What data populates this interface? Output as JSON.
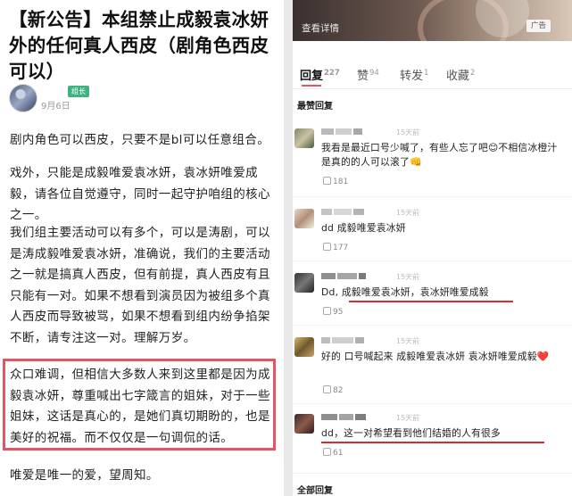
{
  "post": {
    "title": "【新公告】本组禁止成毅袁冰妍外的任何真人西皮（剧角色西皮可以）",
    "author_badge": "组长",
    "date": "9月6日",
    "paragraphs": [
      "剧内角色可以西皮，只要不是bl可以任意组合。",
      "戏外，只能是成毅唯爱袁冰妍，袁冰妍唯爱成毅，请各位自觉遵守，同时一起守护咱组的核心之一。",
      "我们组主要活动可以有多个，可以是涛剧，可以是涛成毅唯爱袁冰妍，准确说，我们的主要活动之一就是搞真人西皮，但有前提，真人西皮有且只能有一对。如果不想看到演员因为被组多个真人西皮而导致被骂，如果不想看到组内纷争掐架不断，请专注这一对。理解万岁。",
      "众口难调，但相信大多数人来到这里都是因为成毅袁冰妍，尊重喊出七字箴言的姐妹，对于一些姐妹，这话是真心的，是她们真切期盼的，也是美好的祝福。而不仅仅是一句调侃的话。",
      "唯爱是唯一的爱，望周知。"
    ]
  },
  "banner": {
    "view_details": "查看详情",
    "ad_label": "广告"
  },
  "tabs": [
    {
      "label": "回复",
      "count": "227"
    },
    {
      "label": "赞",
      "count": "94"
    },
    {
      "label": "转发",
      "count": "1"
    },
    {
      "label": "收藏",
      "count": "2"
    }
  ],
  "sections": {
    "hot": "最赞回复",
    "all": "全部回复"
  },
  "comments": [
    {
      "time": "15天前",
      "text": "我看是最近口号少喊了，有些人忘了吧😊不相信冰橙汁是真的的人可以滚了👊",
      "likes": "181"
    },
    {
      "time": "15天前",
      "text": "dd 成毅唯爱袁冰妍",
      "likes": "177"
    },
    {
      "time": "15天前",
      "text": "Dd, 成毅唯爱袁冰妍，袁冰妍唯爱成毅",
      "likes": "95"
    },
    {
      "time": "15天前",
      "text": "好的 口号喊起来 成毅唯爱袁冰妍 袁冰妍唯爱成毅❤️",
      "likes": "82"
    },
    {
      "time": "15天前",
      "text": "dd，这一对希望看到他们结婚的人有很多",
      "likes": "61"
    }
  ],
  "colors": {
    "highlight_box": "#e05663",
    "underline": "#d92b2b",
    "tab_accent": "#e05663"
  }
}
